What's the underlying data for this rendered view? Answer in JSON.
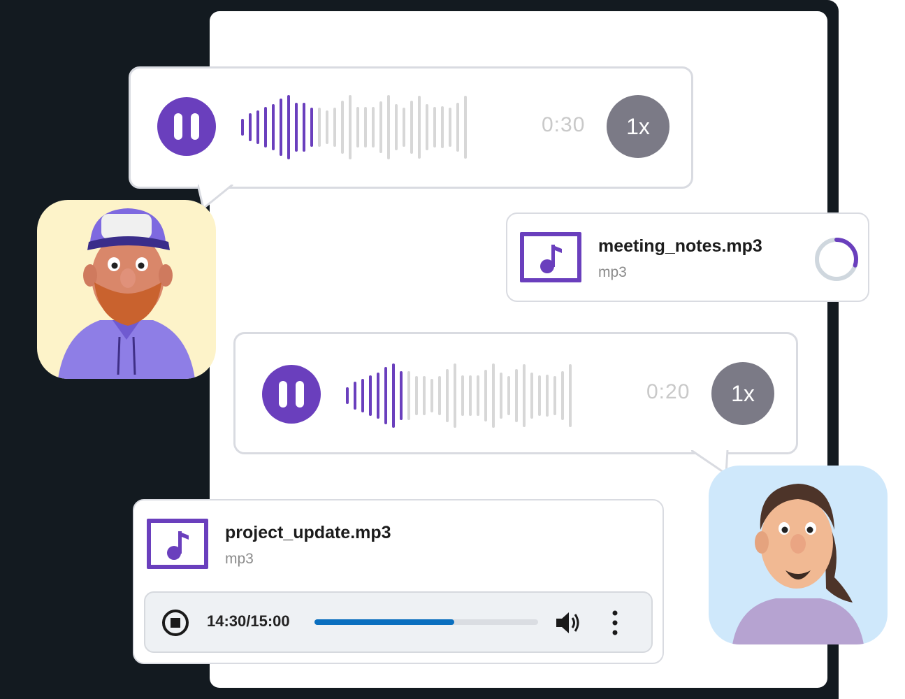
{
  "voice_messages": [
    {
      "duration": "0:30",
      "speed": "1x",
      "progress": 0.33
    },
    {
      "duration": "0:20",
      "speed": "1x",
      "progress": 0.25
    }
  ],
  "files": [
    {
      "name": "meeting_notes.mp3",
      "type": "mp3",
      "upload_progress": 0.3
    },
    {
      "name": "project_update.mp3",
      "type": "mp3"
    }
  ],
  "player": {
    "time": "14:30/15:00",
    "progress": 0.625
  },
  "colors": {
    "accent": "#6a3fbd",
    "dark_bg": "#131a20",
    "progress": "#0a6fbf",
    "speed_badge": "#7b7a86"
  },
  "icons": [
    "pause-icon",
    "music-note-icon",
    "stop-icon",
    "volume-icon",
    "more-vertical-icon"
  ]
}
